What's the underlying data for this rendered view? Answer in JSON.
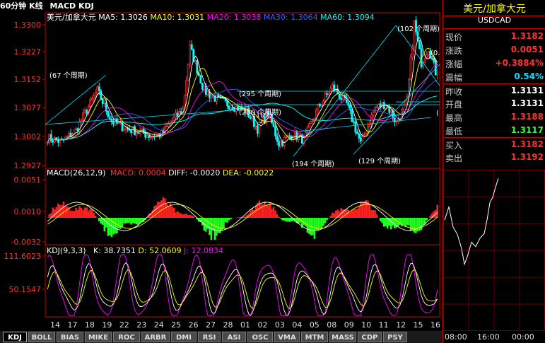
{
  "window": {
    "timeframe": "60分钟 K线",
    "indicators": "MACD KDJ"
  },
  "main_chart": {
    "symbol": "美元/加拿大元",
    "ma": [
      {
        "label": "MA5:",
        "value": "1.3026",
        "color": "#ffffff"
      },
      {
        "label": "MA10:",
        "value": "1.3031",
        "color": "#ffff00"
      },
      {
        "label": "MA20:",
        "value": "1.3038",
        "color": "#ff00ff"
      },
      {
        "label": "MA30:",
        "value": "1.3064",
        "color": "#3060ff"
      },
      {
        "label": "MA60:",
        "value": "1.3094",
        "color": "#00ffff"
      }
    ],
    "price_ticks": [
      "1.3300",
      "1.3227",
      "1.3152",
      "1.3077",
      "1.3002",
      "1.2927"
    ],
    "annotations": [
      "(67 个周期)",
      "(295 个周期)",
      "(280 个周期)",
      "(102)",
      "(194 个周期)",
      "(129 个周期)",
      "(102 个周期)",
      "(0.",
      "("
    ]
  },
  "macd": {
    "title": "MACD(26,12,9)",
    "macd": "MACD: 0.0004",
    "diff": "DIFF: -0.0020",
    "dea": "DEA: -0.0022",
    "ticks": [
      "0.0051",
      "0.0010",
      "-0.0032"
    ]
  },
  "kdj": {
    "title": "KDJ(9,3,3)",
    "k": "K: 38.7351",
    "d": "D: 52.0609",
    "j": "J: 12.0834",
    "ticks": [
      "111.6023",
      "50.1547"
    ]
  },
  "date_labels": [
    "14",
    "17",
    "18",
    "19",
    "22",
    "23",
    "24",
    "25",
    "26",
    "27",
    "28",
    "01",
    "02",
    "03",
    "04",
    "05",
    "08",
    "09",
    "10",
    "11",
    "12",
    "15",
    "16"
  ],
  "tabs": [
    "KDJ",
    "BOLL",
    "BIAS",
    "MIKE",
    "ROC",
    "ARBR",
    "DMI",
    "RSI",
    "ASI",
    "OSC",
    "VMA",
    "MTM",
    "MASS",
    "CDP",
    "PSY"
  ],
  "quote_panel": {
    "title": "美元/加拿大元",
    "code": "USDCAD",
    "rows": [
      {
        "label": "现价",
        "value": "1.3182",
        "color": "#ff3030"
      },
      {
        "label": "涨跌",
        "value": "0.0051",
        "color": "#ff3030"
      },
      {
        "label": "涨幅",
        "value": "+0.3884%",
        "color": "#ff3030"
      },
      {
        "label": "震幅",
        "value": "0.54%",
        "color": "#00e0ff"
      },
      {
        "label": "昨收",
        "value": "1.3131",
        "color": "#ffffff"
      },
      {
        "label": "开盘",
        "value": "1.3131",
        "color": "#ffffff"
      },
      {
        "label": "最高",
        "value": "1.3188",
        "color": "#ff3030"
      },
      {
        "label": "最低",
        "value": "1.3117",
        "color": "#30ff30"
      },
      {
        "label": "买入",
        "value": "1.3182",
        "color": "#ff3030"
      },
      {
        "label": "卖出",
        "value": "1.3192",
        "color": "#ff3030"
      }
    ],
    "time_labels": [
      "08:00",
      "16:00",
      "00:00"
    ]
  }
}
